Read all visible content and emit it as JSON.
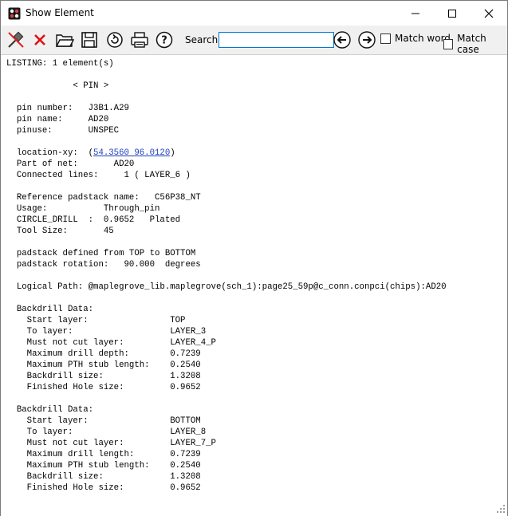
{
  "window": {
    "title": "Show Element"
  },
  "toolbar": {
    "search_label": "Search:",
    "search_value": "",
    "match_word_label": "Match word",
    "match_case_label": "Match case",
    "icons": [
      "pin-icon",
      "close-x-icon",
      "open-folder-icon",
      "save-disk-icon",
      "refresh-icon",
      "print-icon",
      "help-icon",
      "prev-arrow-icon",
      "next-arrow-icon"
    ]
  },
  "listing": {
    "header": "LISTING: 1 element(s)",
    "section": "             < PIN >",
    "pin_number": "  pin number:   J3B1.A29",
    "pin_name": "  pin name:     AD20",
    "pinuse": "  pinuse:       UNSPEC",
    "location_prefix": "  location-xy:  (",
    "location_link": "54.3560 96.0120",
    "location_suffix": ")",
    "part_of_net": "  Part of net:       AD20",
    "connected_lines": "  Connected lines:     1 ( LAYER_6 )",
    "ref_padstack": "  Reference padstack name:   C56P38_NT",
    "usage": "  Usage:           Through_pin",
    "circle_drill": "  CIRCLE_DRILL  :  0.9652   Plated",
    "tool_size": "  Tool Size:       45",
    "padstack_defined": "  padstack defined from TOP to BOTTOM",
    "padstack_rotation": "  padstack rotation:   90.000  degrees",
    "logical_path": "  Logical Path: @maplegrove_lib.maplegrove(sch_1):page25_59p@c_conn.conpci(chips):AD20",
    "backdrill_1": [
      "  Backdrill Data:",
      "    Start layer:                TOP",
      "    To layer:                   LAYER_3",
      "    Must not cut layer:         LAYER_4_P",
      "    Maximum drill depth:        0.7239",
      "    Maximum PTH stub length:    0.2540",
      "    Backdrill size:             1.3208",
      "    Finished Hole size:         0.9652"
    ],
    "backdrill_2": [
      "  Backdrill Data:",
      "    Start layer:                BOTTOM",
      "    To layer:                   LAYER_8",
      "    Must not cut layer:         LAYER_7_P",
      "    Maximum drill length:       0.7239",
      "    Maximum PTH stub length:    0.2540",
      "    Backdrill size:             1.3208",
      "    Finished Hole size:         0.9652"
    ]
  }
}
